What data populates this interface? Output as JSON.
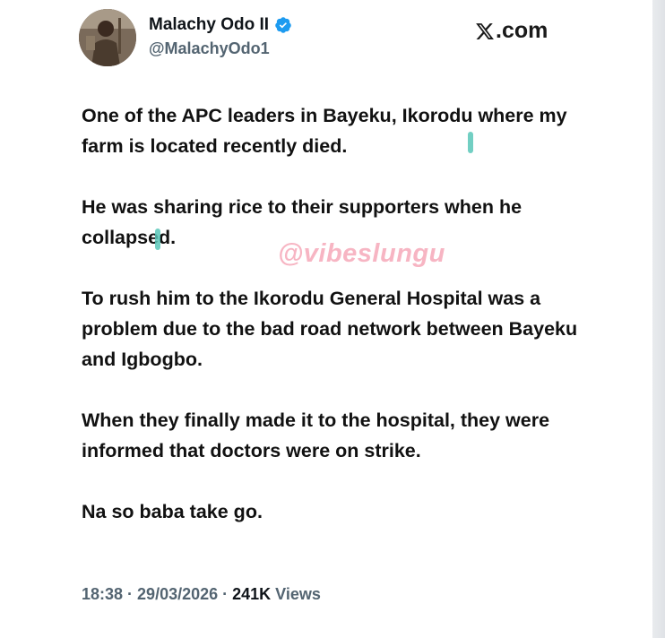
{
  "author": {
    "name": "Malachy Odo II",
    "handle": "@MalachyOdo1",
    "verified": true,
    "verified_color": "#1d9bf0"
  },
  "source": {
    "label": ".com",
    "logo": "x-logo-icon"
  },
  "tweet": {
    "paragraphs": [
      "One of the APC leaders in Bayeku, Ikorodu where my farm is located recently died.",
      "He was sharing rice to their supporters when he collapsed.",
      "To rush him to the Ikorodu General Hospital was a problem due to the bad road network between Bayeku and Igbogbo.",
      "When they finally made it to the hospital, they were informed that doctors were on strike.",
      "Na so baba take go."
    ]
  },
  "watermark": "@vibeslungu",
  "meta": {
    "time": "18:38",
    "separator": "·",
    "date": "29/03/2026",
    "views_count": "241K",
    "views_label": "Views"
  },
  "colors": {
    "text": "#0f1419",
    "secondary": "#536471",
    "watermark": "#f396aa",
    "highlight": "#59c7b9"
  }
}
